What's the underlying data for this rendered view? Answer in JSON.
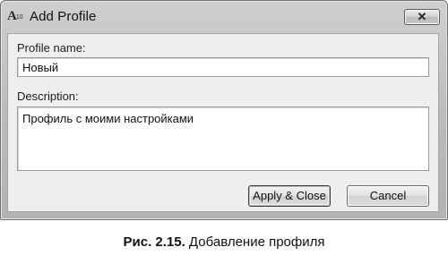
{
  "window": {
    "icon_text": "A",
    "icon_subtext": "10",
    "title": "Add Profile",
    "close_symbol": "✕"
  },
  "form": {
    "profile_name_label": "Profile name:",
    "profile_name_value": "Новый",
    "description_label": "Description:",
    "description_value": "Профиль с моими настройками"
  },
  "buttons": {
    "apply_close": "Apply & Close",
    "cancel": "Cancel"
  },
  "caption": {
    "number": "Рис. 2.15.",
    "text": " Добавление профиля"
  }
}
